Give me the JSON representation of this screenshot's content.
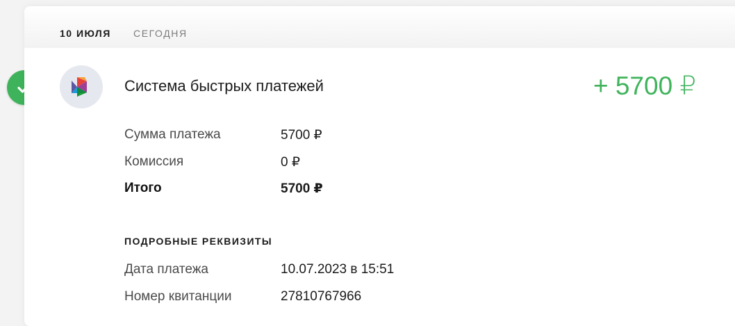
{
  "header": {
    "date": "10 ИЮЛЯ",
    "day_label": "СЕГОДНЯ"
  },
  "operation": {
    "status_icon": "checkmark-icon",
    "merchant_logo": "sbp-logo-icon",
    "merchant_name": "Система быстрых платежей",
    "amount": "+ 5700 ₽",
    "amount_color": "#3fb35b"
  },
  "summary": [
    {
      "label": "Сумма платежа",
      "value": "5700 ₽"
    },
    {
      "label": "Комиссия",
      "value": "0 ₽"
    },
    {
      "label": "Итого",
      "value": "5700 ₽"
    }
  ],
  "details": {
    "title": "ПОДРОБНЫЕ РЕКВИЗИТЫ",
    "rows": [
      {
        "label": "Дата платежа",
        "value": "10.07.2023 в 15:51"
      },
      {
        "label": "Номер квитанции",
        "value": "27810767966"
      }
    ]
  }
}
